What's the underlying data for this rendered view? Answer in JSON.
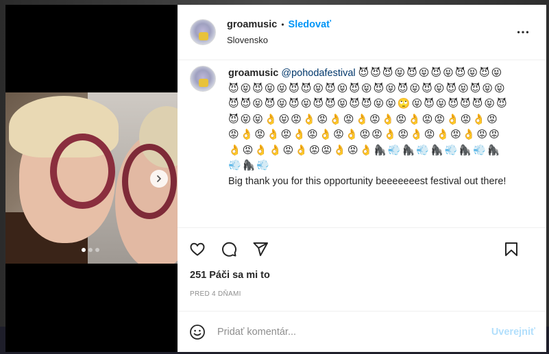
{
  "post": {
    "username": "groamusic",
    "separator": "•",
    "follow_label": "Sledovať",
    "location": "Slovensko"
  },
  "caption": {
    "username": "groamusic",
    "mention": "@pohodafestival",
    "emoji_line_1": "😈😈😈😝😈😝😈😝😈😝",
    "emoji_line_2": "😈😝😈😝😈😝😝😈😈😝😈😝😈😝😈😝😈😝😈",
    "emoji_line_3": "😝😈😝😈😝😝😈😈😝😈😝😈😝😈😈😝😈😈😝",
    "emoji_line_4": "😝🙄😝😈😝😈😈😈😝😈😈😝😝👌😝😡👌😡",
    "emoji_line_5": "👌😡👌😡👌😡👌😡😡👌😡👌😡😡👌😡👌😡",
    "emoji_line_6": "👌😡👌😡👌😡😡👌😡👌😡👌😡👌😡😡👌",
    "emoji_line_7": "😡👌👌😡👌😡😡👌😡👌🦍💨🦍💨🦍💨🦍💨",
    "emoji_line_8": "🦍💨🦍💨",
    "text": "Big thank you for this opportunity beeeeeeest festival out there!"
  },
  "stats": {
    "likes": "251 Páči sa mi to",
    "time": "PRED 4 DŇAMI"
  },
  "comment": {
    "placeholder": "Pridať komentár...",
    "post_label": "Uverejniť"
  },
  "icons": {
    "like": "heart-icon",
    "comment": "comment-icon",
    "share": "share-icon",
    "save": "bookmark-icon",
    "more": "more-icon",
    "next": "chevron-right-icon",
    "emoji": "smiley-icon"
  },
  "carousel": {
    "slides": 3,
    "active": 1
  },
  "colors": {
    "follow": "#0095f6",
    "mention": "#00376b",
    "post_disabled": "#b2dffc",
    "muted": "#8e8e8e"
  }
}
